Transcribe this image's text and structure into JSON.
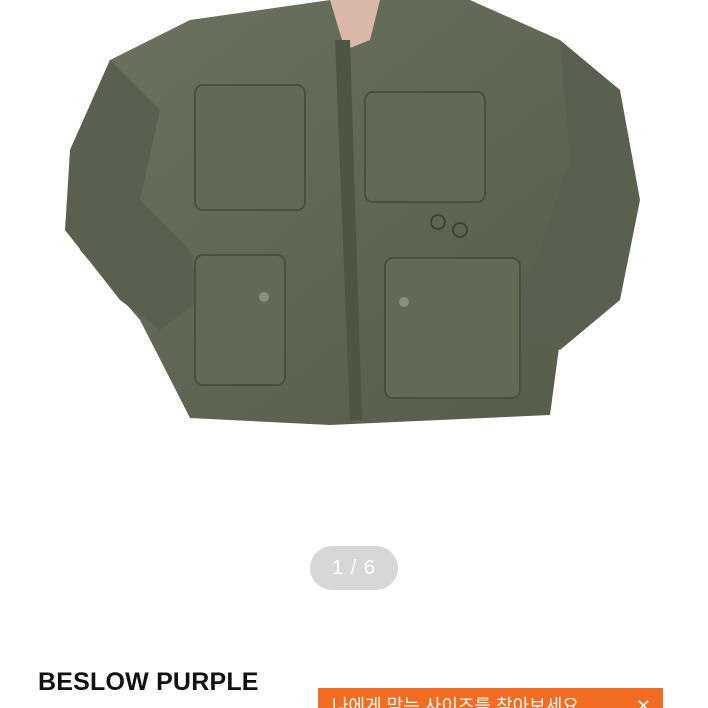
{
  "product": {
    "image_icon": "jacket-photo",
    "pager": "1 / 6",
    "brand_title": "BESLOW PURPLE"
  },
  "banner": {
    "text": "나에게 맞는 사이즈를 찾아보세요",
    "close_glyph": "✕",
    "color": "#f26c21"
  },
  "colors": {
    "jacket": "#5f6652",
    "pager_bg": "#d7d7d7"
  }
}
